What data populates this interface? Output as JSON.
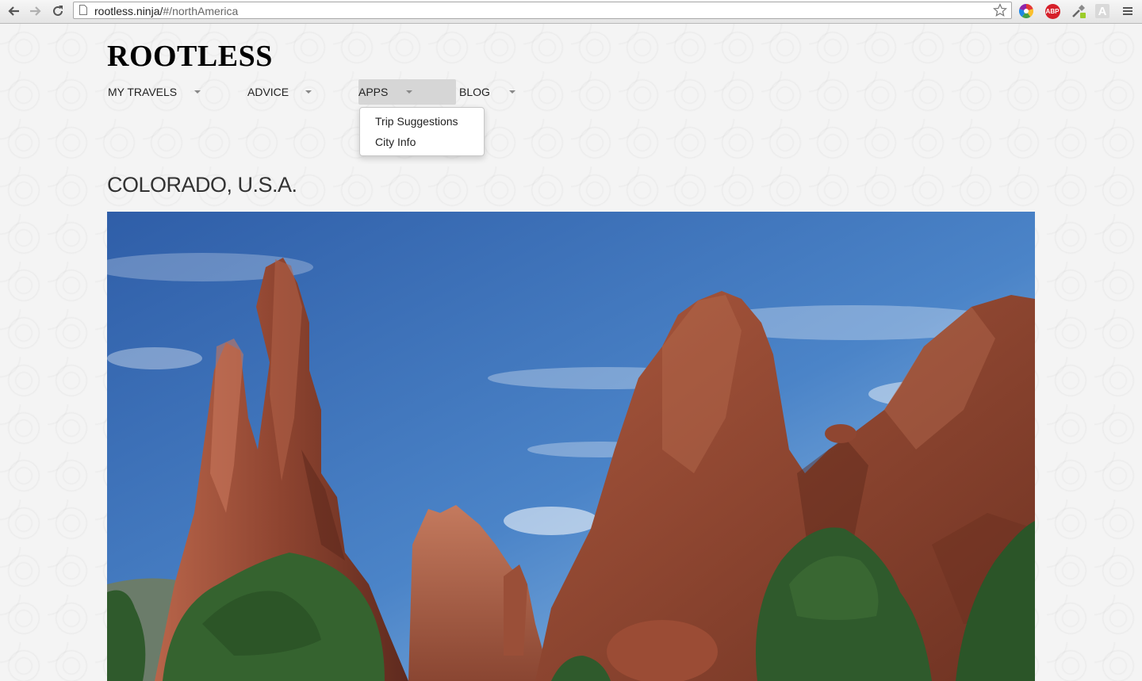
{
  "browser": {
    "url_host": "rootless.ninja/",
    "url_path": "#/northAmerica",
    "extensions": [
      "color-wheel-icon",
      "adblock-icon",
      "eyedropper-icon",
      "translate-icon"
    ],
    "abp_label": "ABP",
    "a_label": "A"
  },
  "site": {
    "logo": "ROOTLESS"
  },
  "nav": {
    "items": [
      {
        "label": "MY TRAVELS"
      },
      {
        "label": "ADVICE"
      },
      {
        "label": "APPS"
      },
      {
        "label": "BLOG"
      }
    ],
    "dropdown": [
      "Trip Suggestions",
      "City Info"
    ]
  },
  "main": {
    "heading": "COLORADO, U.S.A."
  },
  "colors": {
    "sky": "#3a6db8",
    "rock": "#8e4430",
    "tree": "#2f5a2c"
  }
}
